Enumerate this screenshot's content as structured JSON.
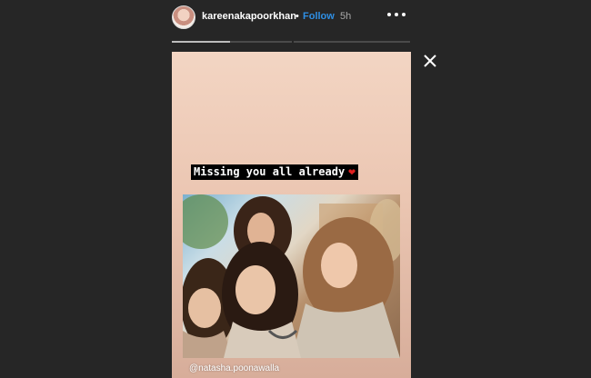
{
  "header": {
    "username": "kareenakapoorkhan",
    "separator": "•",
    "follow_label": "Follow",
    "time": "5h",
    "avatar_icon": "profile-avatar",
    "more_icon": "more-options-icon"
  },
  "progress": {
    "segments": 2,
    "current_segment": 1,
    "current_fraction": 0.5
  },
  "close_icon": "close-icon",
  "story": {
    "caption": "Missing you all already",
    "caption_emoji": "❤",
    "mention": "@natasha.poonawalla"
  },
  "colors": {
    "background": "#262626",
    "follow": "#2f8fe4",
    "heart": "#e02020",
    "caption_bg": "#000000"
  }
}
